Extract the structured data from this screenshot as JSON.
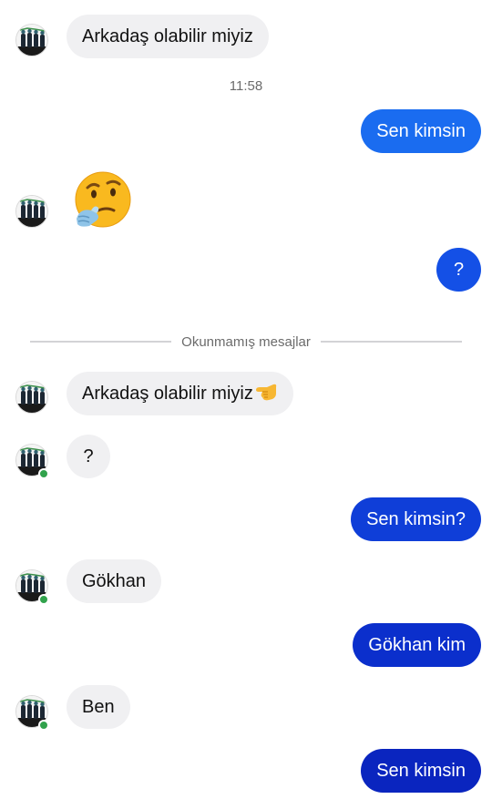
{
  "messages": {
    "m1": {
      "text": "Arkadaş olabilir miyiz",
      "side": "incoming"
    },
    "time_separator": "11:58",
    "m2": {
      "text": "Sen kimsin",
      "side": "outgoing",
      "color": "#1a6cf0"
    },
    "m3": {
      "emoji": "thinking-face",
      "side": "incoming"
    },
    "m4": {
      "text": "?",
      "side": "outgoing",
      "color": "#1450e6"
    },
    "unread_separator": "Okunmamış mesajlar",
    "m5": {
      "text": "Arkadaş olabilir miyiz",
      "emoji": "pointing-left-hand",
      "side": "incoming"
    },
    "m6": {
      "text": "?",
      "side": "incoming"
    },
    "m7": {
      "text": "Sen kimsin?",
      "side": "outgoing",
      "color": "#0f3ed8"
    },
    "m8": {
      "text": "Gökhan",
      "side": "incoming"
    },
    "m9": {
      "text": "Gökhan kim",
      "side": "outgoing",
      "color": "#0b2fcc"
    },
    "m10": {
      "text": "Ben",
      "side": "incoming"
    },
    "m11": {
      "text": "Sen kimsin",
      "side": "outgoing",
      "color": "#0a25bf"
    }
  },
  "colors": {
    "incoming_bubble": "#f0f0f2",
    "online_indicator": "#31a24c"
  }
}
